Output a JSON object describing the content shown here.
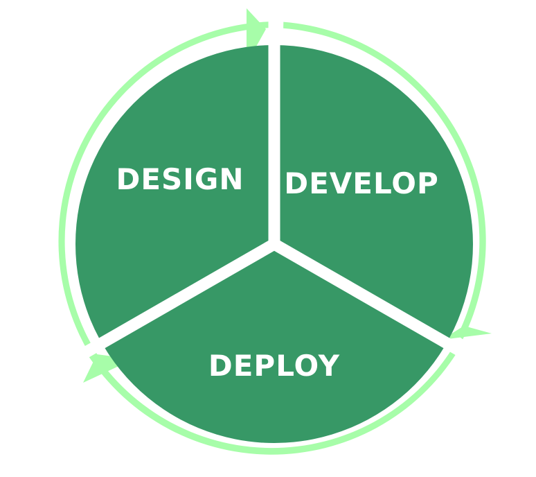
{
  "diagram": {
    "type": "cycle",
    "stages": [
      {
        "label": "DESIGN"
      },
      {
        "label": "DEVELOP"
      },
      {
        "label": "DEPLOY"
      }
    ],
    "colors": {
      "background": "#ffffff",
      "segment_fill": "#379866",
      "ring_arrow": "#a7fda9",
      "separator": "#ffffff",
      "label_text": "#ffffff"
    }
  }
}
